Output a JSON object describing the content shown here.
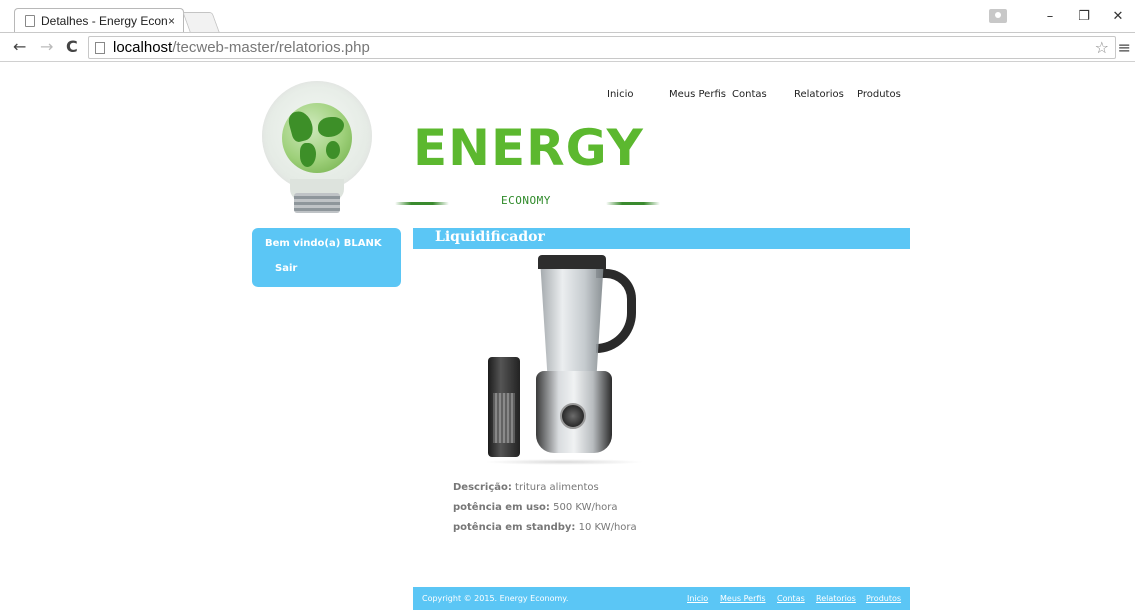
{
  "browser": {
    "tab_title": "Detalhes - Energy Econom",
    "tab_close": "×",
    "url_host": "localhost",
    "url_path": "/tecweb-master/relatorios.php",
    "back": "←",
    "forward": "→",
    "reload": "C",
    "star": "☆",
    "menu": "≡",
    "minimize": "–",
    "restore": "❐",
    "close": "✕"
  },
  "header": {
    "brand": "ENERGY",
    "tagline": "ECONOMY",
    "nav": [
      "Inicio",
      "Meus Perfis",
      "Contas",
      "Relatorios",
      "Produtos"
    ]
  },
  "sidebar": {
    "welcome": "Bem vindo(a) BLANK",
    "logout": "Sair"
  },
  "product": {
    "name": "Liquidificador",
    "image_icon": "blender-image",
    "description_label": "Descrição:",
    "description_value": " tritura alimentos",
    "power_use_label": "potência em uso:",
    "power_use_value": " 500 KW/hora",
    "power_standby_label": "potência em standby:",
    "power_standby_value": " 10 KW/hora"
  },
  "footer": {
    "copyright": "Copyright © 2015. Energy Economy.",
    "links": [
      "Inicio",
      "Meus Perfis",
      "Contas",
      "Relatorios",
      "Produtos"
    ]
  },
  "colors": {
    "accent_blue": "#5bc6f5",
    "brand_green": "#5cb82f",
    "text_gray": "#777777"
  }
}
